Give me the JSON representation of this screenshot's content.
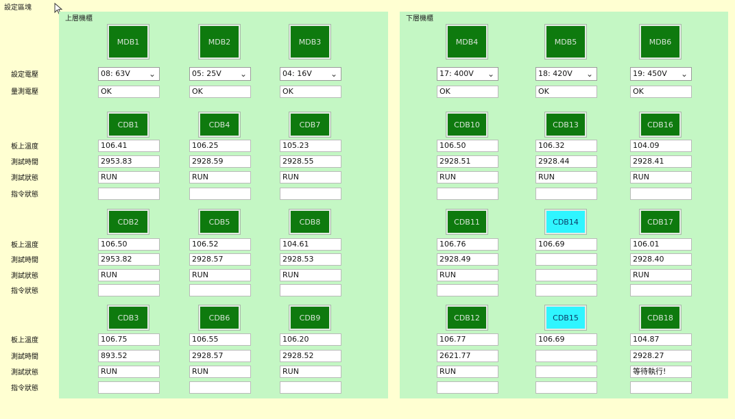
{
  "area_title": "設定區塊",
  "panels": {
    "upper": "上層機櫃",
    "lower": "下層機櫃"
  },
  "labels": {
    "set_voltage": "設定電壓",
    "measured_voltage": "量測電壓",
    "board_temp": "板上溫度",
    "test_time": "測試時間",
    "test_status": "測試狀態",
    "command_status": "指令狀態"
  },
  "mdb": [
    {
      "name": "MDB1",
      "voltage": "08: 63V",
      "measured": "OK"
    },
    {
      "name": "MDB2",
      "voltage": "05: 25V",
      "measured": "OK"
    },
    {
      "name": "MDB3",
      "voltage": "04: 16V",
      "measured": "OK"
    },
    {
      "name": "MDB4",
      "voltage": "17: 400V",
      "measured": "OK"
    },
    {
      "name": "MDB5",
      "voltage": "18: 420V",
      "measured": "OK"
    },
    {
      "name": "MDB6",
      "voltage": "19: 450V",
      "measured": "OK"
    }
  ],
  "cdb_rows": [
    [
      {
        "name": "CDB1",
        "temp": "106.41",
        "time": "2953.83",
        "status": "RUN",
        "cmd": "",
        "highlight": false
      },
      {
        "name": "CDB4",
        "temp": "106.25",
        "time": "2928.59",
        "status": "RUN",
        "cmd": "",
        "highlight": false
      },
      {
        "name": "CDB7",
        "temp": "105.23",
        "time": "2928.55",
        "status": "RUN",
        "cmd": "",
        "highlight": false
      },
      {
        "name": "CDB10",
        "temp": "106.50",
        "time": "2928.51",
        "status": "RUN",
        "cmd": "",
        "highlight": false
      },
      {
        "name": "CDB13",
        "temp": "106.32",
        "time": "2928.44",
        "status": "RUN",
        "cmd": "",
        "highlight": false
      },
      {
        "name": "CDB16",
        "temp": "104.09",
        "time": "2928.41",
        "status": "RUN",
        "cmd": "",
        "highlight": false
      }
    ],
    [
      {
        "name": "CDB2",
        "temp": "106.50",
        "time": "2953.82",
        "status": "RUN",
        "cmd": "",
        "highlight": false
      },
      {
        "name": "CDB5",
        "temp": "106.52",
        "time": "2928.57",
        "status": "RUN",
        "cmd": "",
        "highlight": false
      },
      {
        "name": "CDB8",
        "temp": "104.61",
        "time": "2928.53",
        "status": "RUN",
        "cmd": "",
        "highlight": false
      },
      {
        "name": "CDB11",
        "temp": "106.76",
        "time": "2928.49",
        "status": "RUN",
        "cmd": "",
        "highlight": false
      },
      {
        "name": "CDB14",
        "temp": "106.69",
        "time": "",
        "status": "",
        "cmd": "",
        "highlight": true
      },
      {
        "name": "CDB17",
        "temp": "106.01",
        "time": "2928.40",
        "status": "RUN",
        "cmd": "",
        "highlight": false
      }
    ],
    [
      {
        "name": "CDB3",
        "temp": "106.75",
        "time": "893.52",
        "status": "RUN",
        "cmd": "",
        "highlight": false
      },
      {
        "name": "CDB6",
        "temp": "106.55",
        "time": "2928.57",
        "status": "RUN",
        "cmd": "",
        "highlight": false
      },
      {
        "name": "CDB9",
        "temp": "106.20",
        "time": "2928.52",
        "status": "RUN",
        "cmd": "",
        "highlight": false
      },
      {
        "name": "CDB12",
        "temp": "106.77",
        "time": "2621.77",
        "status": "RUN",
        "cmd": "",
        "highlight": false
      },
      {
        "name": "CDB15",
        "temp": "106.69",
        "time": "",
        "status": "",
        "cmd": "",
        "highlight": true
      },
      {
        "name": "CDB18",
        "temp": "104.87",
        "time": "2928.27",
        "status": "等待執行!",
        "cmd": "",
        "highlight": false
      }
    ]
  ],
  "colors": {
    "background": "#ffffd2",
    "panel": "#c4f7c4",
    "button_green": "#0e7a0e",
    "button_cyan": "#2ff5ff"
  }
}
